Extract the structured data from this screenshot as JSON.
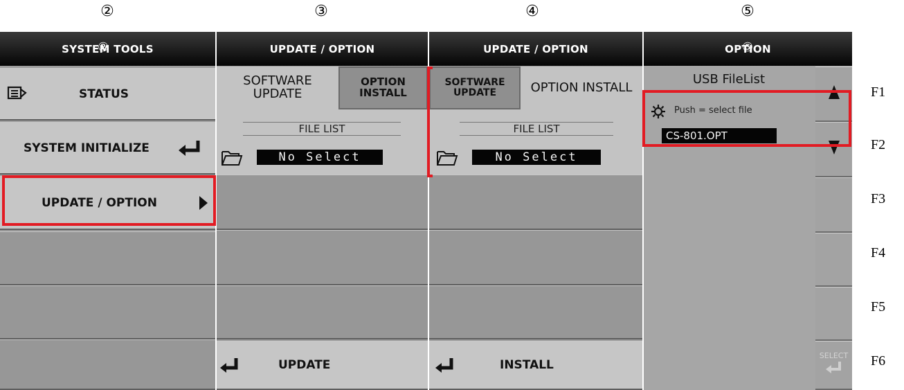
{
  "step_numbers": [
    "②",
    "③",
    "④",
    "⑤"
  ],
  "panel1": {
    "title": "SYSTEM TOOLS",
    "title_overlay": "②",
    "status_label": "STATUS",
    "status_icon": "list-icon",
    "init_label": "SYSTEM INITIALIZE",
    "init_icon": "enter-arrow-icon",
    "update_label": "UPDATE / OPTION",
    "update_icon": "play-right-icon"
  },
  "panel2": {
    "title": "UPDATE / OPTION",
    "tab_software": "SOFTWARE UPDATE",
    "tab_option": "OPTION INSTALL",
    "file_list_label": "FILE LIST",
    "file_value": "No Select",
    "action_label": "UPDATE",
    "folder_icon": "folder-icon",
    "action_icon": "enter-arrow-icon"
  },
  "panel3": {
    "title": "UPDATE / OPTION",
    "tab_software": "SOFTWARE UPDATE",
    "tab_option": "OPTION INSTALL",
    "file_list_label": "FILE LIST",
    "file_value": "No Select",
    "action_label": "INSTALL"
  },
  "panel4": {
    "title": "OPTION",
    "title_overlay": "⑤",
    "list_title": "USB FileList",
    "hint": "Push = select file",
    "hint_icon": "gear-icon",
    "file_item": "CS-801.OPT",
    "select_label": "SELECT",
    "up_icon": "arrow-up-icon",
    "down_icon": "arrow-down-icon"
  },
  "fkeys": [
    "F1",
    "F2",
    "F3",
    "F4",
    "F5",
    "F6"
  ],
  "colors": {
    "highlight": "#e21b23",
    "titlebar": "#050505",
    "button": "#9f9f9f"
  }
}
